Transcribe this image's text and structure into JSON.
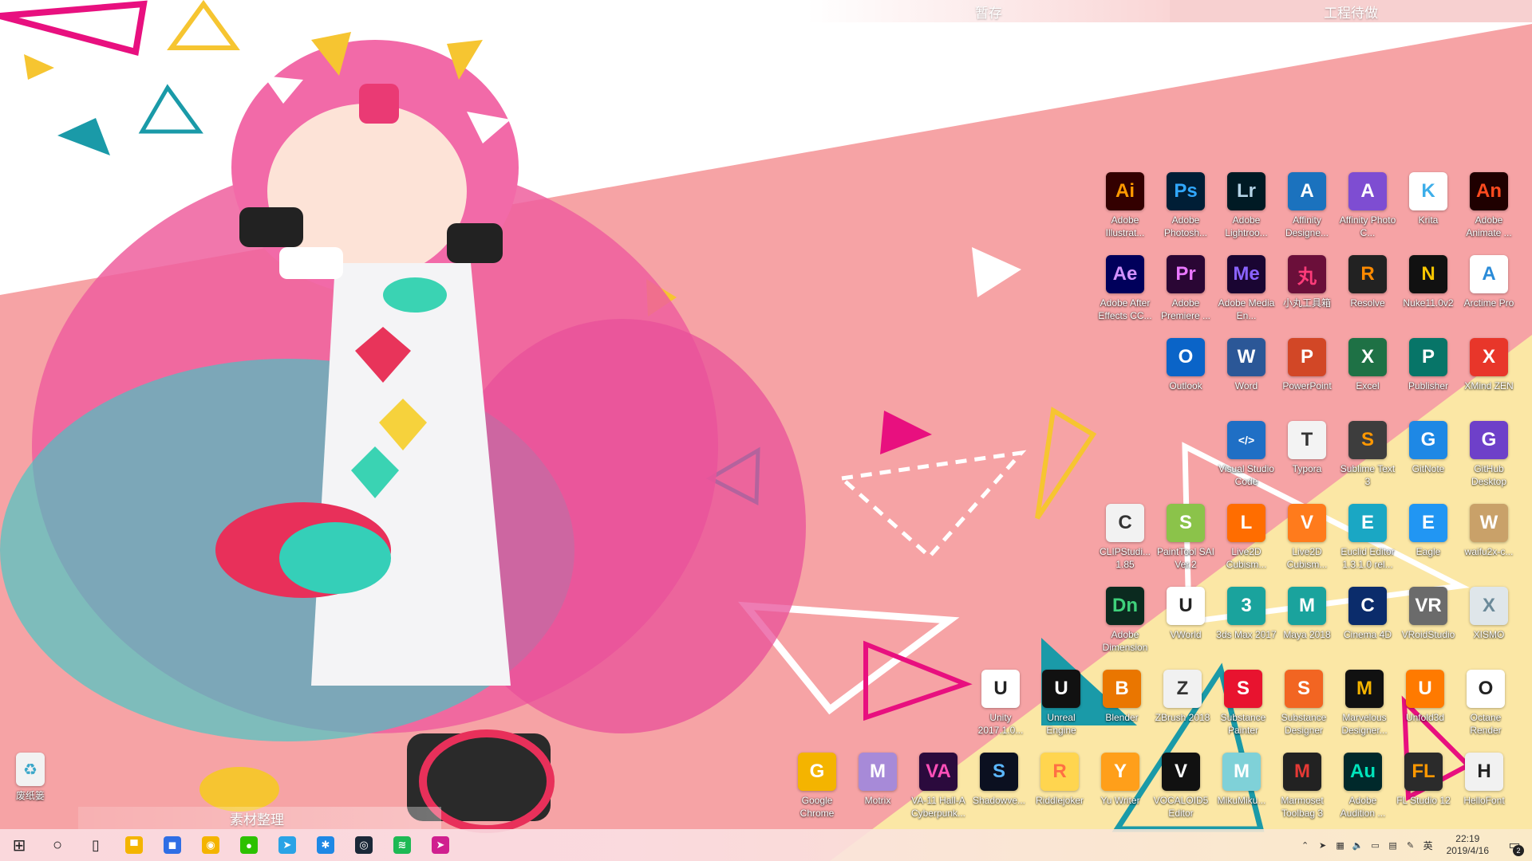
{
  "fences": {
    "stash": "暂存",
    "todo": "工程待做",
    "material": "素材整理"
  },
  "recycle_bin": {
    "label": "废纸篓"
  },
  "desktop_icons": [
    {
      "label": "Adobe Illustrat...",
      "glyph": "Ai",
      "color": "#330000",
      "fg": "#ff9a00"
    },
    {
      "label": "Adobe Photosh...",
      "glyph": "Ps",
      "color": "#001e36",
      "fg": "#31a8ff"
    },
    {
      "label": "Adobe Lightroo...",
      "glyph": "Lr",
      "color": "#001a24",
      "fg": "#b4d3e6"
    },
    {
      "label": "Affinity Designe...",
      "glyph": "A",
      "color": "#1b72be",
      "fg": "#ffffff"
    },
    {
      "label": "Affinity Photo C...",
      "glyph": "A",
      "color": "#7e4dd2",
      "fg": "#ffffff"
    },
    {
      "label": "Krita",
      "glyph": "K",
      "color": "#ffffff",
      "fg": "#3daee9"
    },
    {
      "label": "Adobe Animate ...",
      "glyph": "An",
      "color": "#1f0000",
      "fg": "#ff4b1f"
    },
    {
      "label": "Adobe After Effects CC...",
      "glyph": "Ae",
      "color": "#00005b",
      "fg": "#d291ff"
    },
    {
      "label": "Adobe Premiere ...",
      "glyph": "Pr",
      "color": "#2a0634",
      "fg": "#ea77ff"
    },
    {
      "label": "Adobe Media En...",
      "glyph": "Me",
      "color": "#1a0532",
      "fg": "#8a63ff"
    },
    {
      "label": "小丸工具箱",
      "glyph": "丸",
      "color": "#6b0f3a",
      "fg": "#ff3c7a"
    },
    {
      "label": "Resolve",
      "glyph": "R",
      "color": "#222222",
      "fg": "#ff8a00"
    },
    {
      "label": "Nuke11.0v2",
      "glyph": "N",
      "color": "#111111",
      "fg": "#f7c600"
    },
    {
      "label": "Arctime Pro",
      "glyph": "A",
      "color": "#ffffff",
      "fg": "#2a8bd8"
    },
    {
      "label": "Outlook",
      "glyph": "O",
      "color": "#0a64c8",
      "fg": "#ffffff"
    },
    {
      "label": "Word",
      "glyph": "W",
      "color": "#2b5797",
      "fg": "#ffffff"
    },
    {
      "label": "PowerPoint",
      "glyph": "P",
      "color": "#d24726",
      "fg": "#ffffff"
    },
    {
      "label": "Excel",
      "glyph": "X",
      "color": "#1e7145",
      "fg": "#ffffff"
    },
    {
      "label": "Publisher",
      "glyph": "P",
      "color": "#077568",
      "fg": "#ffffff"
    },
    {
      "label": "XMind ZEN",
      "glyph": "X",
      "color": "#e8362a",
      "fg": "#ffffff"
    },
    {
      "label": "Visual Studio Code",
      "glyph": "&lt;/&gt;",
      "color": "#1f6fc5",
      "fg": "#ffffff"
    },
    {
      "label": "Typora",
      "glyph": "T",
      "color": "#f3f3f3",
      "fg": "#333333"
    },
    {
      "label": "Sublime Text 3",
      "glyph": "S",
      "color": "#3d3d3d",
      "fg": "#ff9800"
    },
    {
      "label": "GitNote",
      "glyph": "G",
      "color": "#1e88e5",
      "fg": "#ffffff"
    },
    {
      "label": "GitHub Desktop",
      "glyph": "G",
      "color": "#6e40c9",
      "fg": "#ffffff"
    },
    {
      "label": "CLIPStudi... 1.85",
      "glyph": "C",
      "color": "#f2f2f2",
      "fg": "#333333"
    },
    {
      "label": "PaintTool SAI Ver.2",
      "glyph": "S",
      "color": "#8bc34a",
      "fg": "#ffffff"
    },
    {
      "label": "Live2D Cubism...",
      "glyph": "L",
      "color": "#ff6d00",
      "fg": "#ffffff"
    },
    {
      "label": "Live2D Cubism...",
      "glyph": "V",
      "color": "#ff7b1c",
      "fg": "#ffffff"
    },
    {
      "label": "Euclid Editor 1.3.1.0 rel...",
      "glyph": "E",
      "color": "#1aa7c4",
      "fg": "#ffffff"
    },
    {
      "label": "Eagle",
      "glyph": "E",
      "color": "#2196f3",
      "fg": "#ffffff"
    },
    {
      "label": "waifu2x-c...",
      "glyph": "W",
      "color": "#c9a169",
      "fg": "#ffffff"
    },
    {
      "label": "Adobe Dimension",
      "glyph": "Dn",
      "color": "#0b2a1f",
      "fg": "#3fd17b"
    },
    {
      "label": "VWorld",
      "glyph": "U",
      "color": "#ffffff",
      "fg": "#222222"
    },
    {
      "label": "3ds Max 2017",
      "glyph": "3",
      "color": "#1aa39d",
      "fg": "#ffffff"
    },
    {
      "label": "Maya 2018",
      "glyph": "M",
      "color": "#1aa39d",
      "fg": "#ffffff"
    },
    {
      "label": "Cinema 4D",
      "glyph": "C",
      "color": "#0b2c6b",
      "fg": "#ffffff"
    },
    {
      "label": "VRoidStudio",
      "glyph": "VR",
      "color": "#6b6b6b",
      "fg": "#ffffff"
    },
    {
      "label": "XISMO",
      "glyph": "X",
      "color": "#dfe6ea",
      "fg": "#6b8a99"
    },
    {
      "label": "Unity 2017.1.0...",
      "glyph": "U",
      "color": "#ffffff",
      "fg": "#222222"
    },
    {
      "label": "Unreal Engine",
      "glyph": "U",
      "color": "#111111",
      "fg": "#ffffff"
    },
    {
      "label": "Blender",
      "glyph": "B",
      "color": "#ea7600",
      "fg": "#ffffff"
    },
    {
      "label": "ZBrush 2018",
      "glyph": "Z",
      "color": "#f1f1f1",
      "fg": "#333333"
    },
    {
      "label": "Substance Painter",
      "glyph": "S",
      "color": "#e8132f",
      "fg": "#ffffff"
    },
    {
      "label": "Substance Designer",
      "glyph": "S",
      "color": "#f26522",
      "fg": "#ffffff"
    },
    {
      "label": "Marvelous Designer...",
      "glyph": "M",
      "color": "#111111",
      "fg": "#f6b400"
    },
    {
      "label": "Unfold3d",
      "glyph": "U",
      "color": "#ff7a00",
      "fg": "#ffffff"
    },
    {
      "label": "Octane Render",
      "glyph": "O",
      "color": "#ffffff",
      "fg": "#222222"
    },
    {
      "label": "Google Chrome",
      "glyph": "G",
      "color": "#f4b400",
      "fg": "#ffffff"
    },
    {
      "label": "Motrix",
      "glyph": "M",
      "color": "#a78ad8",
      "fg": "#ffffff"
    },
    {
      "label": "VA-11 Hall-A Cyberpunk...",
      "glyph": "VA",
      "color": "#2b0a3d",
      "fg": "#ff4fb8"
    },
    {
      "label": "Shadowve...",
      "glyph": "S",
      "color": "#0b1020",
      "fg": "#5bb7ff"
    },
    {
      "label": "Riddlejoker",
      "glyph": "R",
      "color": "#ffd54f",
      "fg": "#ff7043"
    },
    {
      "label": "Yu Writer",
      "glyph": "Y",
      "color": "#ff9f1a",
      "fg": "#ffffff"
    },
    {
      "label": "VOCALOID5 Editor",
      "glyph": "V",
      "color": "#111111",
      "fg": "#ffffff"
    },
    {
      "label": "MikuMiku...",
      "glyph": "M",
      "color": "#7fd1d8",
      "fg": "#ffffff"
    },
    {
      "label": "Marmoset Toolbag 3",
      "glyph": "M",
      "color": "#222222",
      "fg": "#e53935"
    },
    {
      "label": "Adobe Audition ...",
      "glyph": "Au",
      "color": "#00292b",
      "fg": "#00e4bb"
    },
    {
      "label": "FL Studio 12",
      "glyph": "FL",
      "color": "#2b2b2b",
      "fg": "#ff9800"
    },
    {
      "label": "HelloFont",
      "glyph": "H",
      "color": "#f1f1f1",
      "fg": "#222222"
    }
  ],
  "taskbar": {
    "start": {
      "glyph": "⊞"
    },
    "search": {
      "glyph": "○"
    },
    "taskview": {
      "glyph": "▯"
    },
    "apps": [
      {
        "name": "file-explorer",
        "glyph": "▀",
        "color": "#f4b400"
      },
      {
        "name": "store",
        "glyph": "◼",
        "color": "#2f6ee5"
      },
      {
        "name": "chrome",
        "glyph": "◉",
        "color": "#f4b400"
      },
      {
        "name": "wechat",
        "glyph": "●",
        "color": "#2dc100"
      },
      {
        "name": "telegram",
        "glyph": "➤",
        "color": "#2aa3e6"
      },
      {
        "name": "app-star",
        "glyph": "✱",
        "color": "#1e88e5"
      },
      {
        "name": "steam",
        "glyph": "◎",
        "color": "#1b2838"
      },
      {
        "name": "spotify",
        "glyph": "≋",
        "color": "#1db954"
      },
      {
        "name": "pointer",
        "glyph": "➤",
        "color": "#d0208f"
      }
    ]
  },
  "tray": {
    "clock_time": "22:19",
    "clock_date": "2019/4/16",
    "ime": "英",
    "notification_count": "2"
  }
}
